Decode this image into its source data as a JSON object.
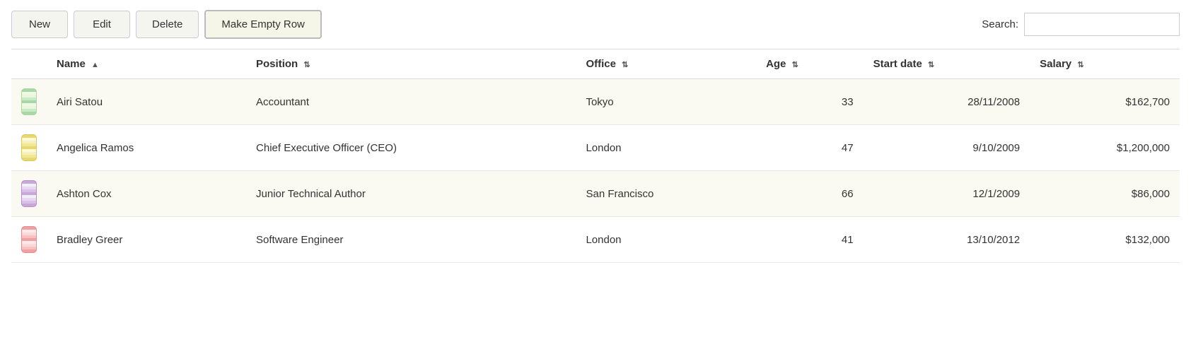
{
  "toolbar": {
    "new_label": "New",
    "edit_label": "Edit",
    "delete_label": "Delete",
    "make_empty_row_label": "Make Empty Row",
    "search_label": "Search:",
    "search_placeholder": ""
  },
  "table": {
    "columns": [
      {
        "id": "icon",
        "label": "",
        "sortable": false
      },
      {
        "id": "name",
        "label": "Name",
        "sortable": true,
        "sort_dir": "asc"
      },
      {
        "id": "position",
        "label": "Position",
        "sortable": true
      },
      {
        "id": "office",
        "label": "Office",
        "sortable": true
      },
      {
        "id": "age",
        "label": "Age",
        "sortable": true
      },
      {
        "id": "start_date",
        "label": "Start date",
        "sortable": true
      },
      {
        "id": "salary",
        "label": "Salary",
        "sortable": true
      }
    ],
    "rows": [
      {
        "id": 1,
        "icon_class": "icon-green",
        "name": "Airi Satou",
        "position": "Accountant",
        "office": "Tokyo",
        "age": "33",
        "start_date": "28/11/2008",
        "salary": "$162,700"
      },
      {
        "id": 2,
        "icon_class": "icon-yellow",
        "name": "Angelica Ramos",
        "position": "Chief Executive Officer (CEO)",
        "office": "London",
        "age": "47",
        "start_date": "9/10/2009",
        "salary": "$1,200,000"
      },
      {
        "id": 3,
        "icon_class": "icon-purple",
        "name": "Ashton Cox",
        "position": "Junior Technical Author",
        "office": "San Francisco",
        "age": "66",
        "start_date": "12/1/2009",
        "salary": "$86,000"
      },
      {
        "id": 4,
        "icon_class": "icon-pink",
        "name": "Bradley Greer",
        "position": "Software Engineer",
        "office": "London",
        "age": "41",
        "start_date": "13/10/2012",
        "salary": "$132,000"
      }
    ]
  }
}
